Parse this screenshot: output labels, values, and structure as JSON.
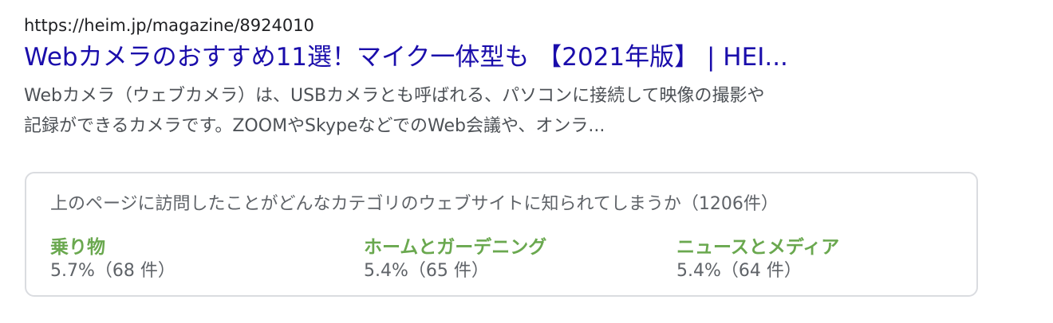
{
  "result": {
    "url": "https://heim.jp/magazine/8924010",
    "title": "Webカメラのおすすめ11選！マイク一体型も 【2021年版】 | HEI...",
    "snippet_line1": "Webカメラ（ウェブカメラ）は、USBカメラとも呼ばれる、パソコンに接続して映像の撮影や",
    "snippet_line2": "記録ができるカメラです。ZOOMやSkypeなどでのWeb会議や、オンラ..."
  },
  "panel": {
    "heading": "上のページに訪問したことがどんなカテゴリのウェブサイトに知られてしまうか（1206件）",
    "categories": [
      {
        "name": "乗り物",
        "stat": "5.7%（68 件）"
      },
      {
        "name": "ホームとガーデニング",
        "stat": "5.4%（65 件）"
      },
      {
        "name": "ニュースとメディア",
        "stat": "5.4%（64 件）"
      }
    ]
  },
  "colors": {
    "link": "#1a0dab",
    "category": "#6aa84f",
    "border": "#dadce0"
  }
}
